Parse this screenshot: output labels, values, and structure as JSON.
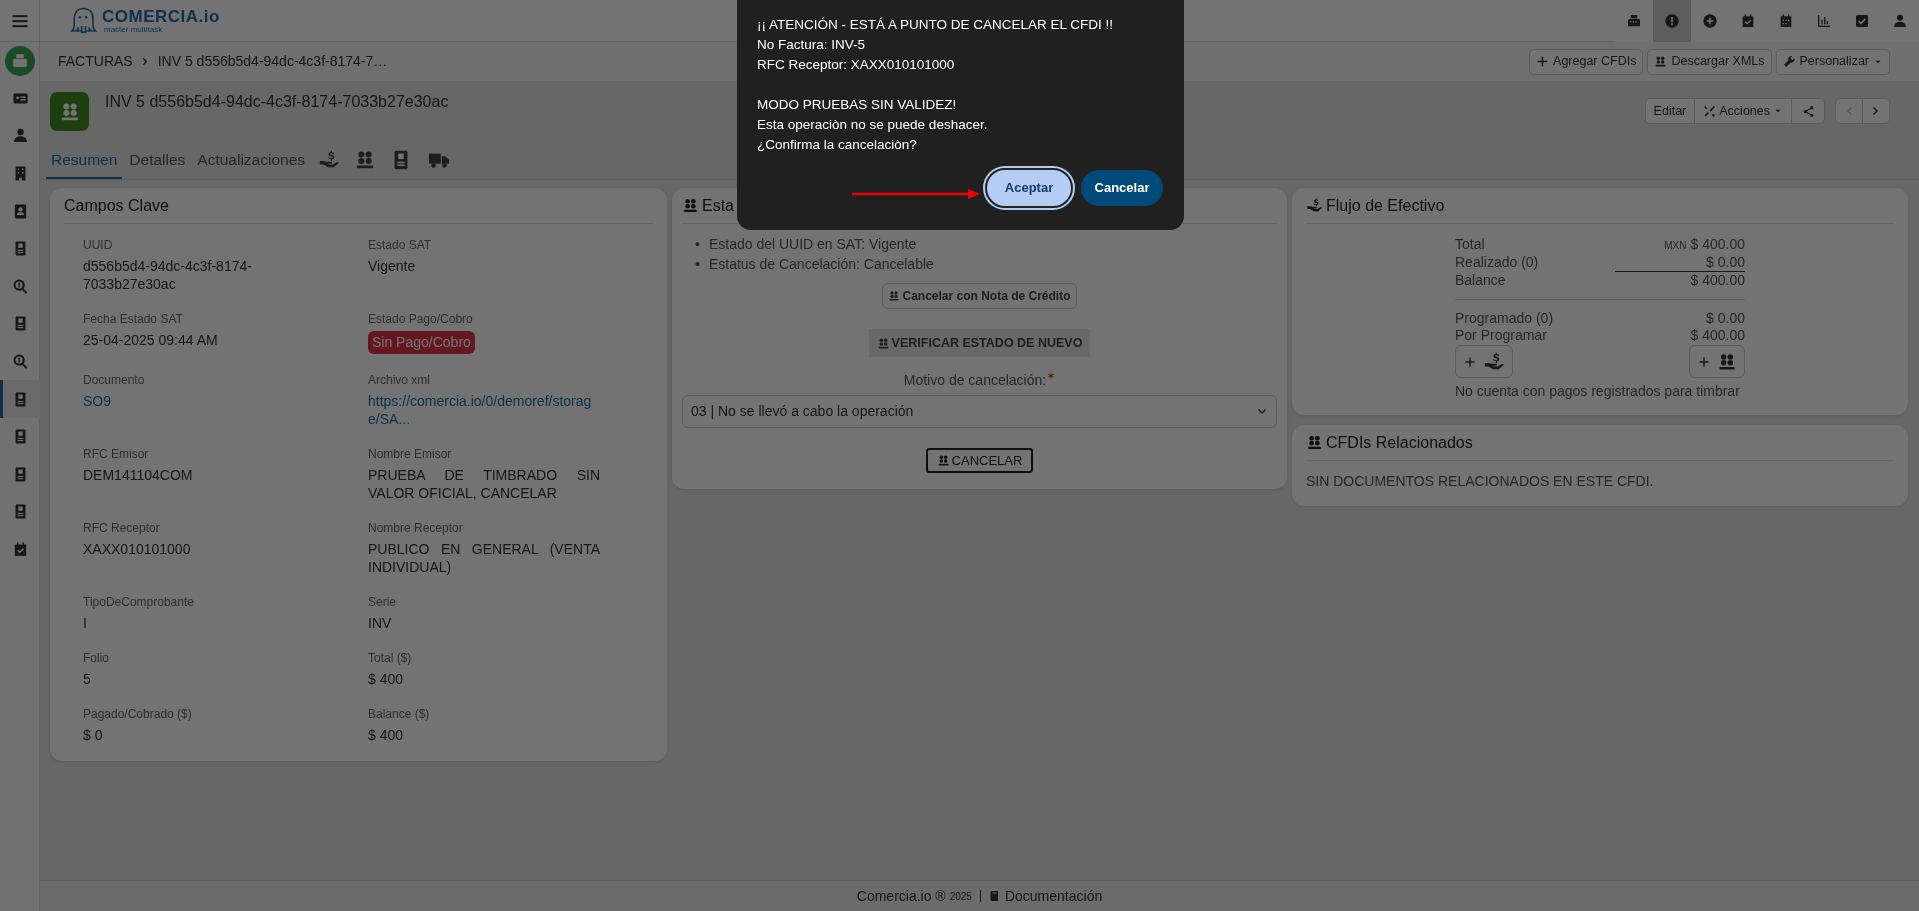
{
  "sidebar": {
    "items": [
      {
        "selected": false
      },
      {
        "selected": false
      },
      {
        "selected": false
      },
      {
        "selected": false
      },
      {
        "selected": false
      },
      {
        "selected": false
      },
      {
        "selected": false
      },
      {
        "selected": false
      },
      {
        "selected": false
      },
      {
        "selected": true
      },
      {
        "selected": false
      },
      {
        "selected": false
      },
      {
        "selected": false
      },
      {
        "selected": false
      }
    ]
  },
  "topbar": {
    "logo": {
      "name": "COMERCIA.io",
      "tagline": "master multitask"
    },
    "icons": [
      {
        "selected": false
      },
      {
        "selected": true
      },
      {
        "selected": false
      },
      {
        "selected": false
      },
      {
        "selected": false
      },
      {
        "selected": false
      },
      {
        "selected": false
      },
      {
        "selected": false
      }
    ]
  },
  "breadcrumb": [
    "FACTURAS",
    "INV 5 d556b5d4-94dc-4c3f-8174-7…"
  ],
  "toolbar_buttons": [
    "Agregar CFDIs",
    "Descargar XMLs",
    "Personalizar"
  ],
  "header": {
    "title": "INV 5 d556b5d4-94dc-4c3f-8174-7033b27e30ac",
    "actions": [
      "Editar",
      "Acciones"
    ]
  },
  "tabs": [
    {
      "label": "Resumen",
      "selected": true
    },
    {
      "label": "Detalles",
      "selected": false
    },
    {
      "label": "Actualizaciones",
      "selected": false
    }
  ],
  "icon_tabs": [
    {
      "selected": false
    },
    {
      "selected": false
    },
    {
      "selected": false
    },
    {
      "selected": false
    }
  ],
  "campos_clave": {
    "title": "Campos Clave",
    "fields": [
      {
        "label": "UUID",
        "value": "d556b5d4-94dc-4c3f-8174-7033b27e30ac",
        "kind": "text"
      },
      {
        "label": "Estado SAT",
        "value": "Vigente",
        "kind": "text"
      },
      {
        "label": "Fecha Estado SAT",
        "value": "25-04-2025 09:44 AM",
        "kind": "text"
      },
      {
        "label": "Estado Pago/Cobro",
        "value": "Sin Pago/Cobro",
        "kind": "badge"
      },
      {
        "label": "Documento",
        "value": "SO9",
        "kind": "link"
      },
      {
        "label": "Archivo xml",
        "value": "https://comercia.io/0/demoref/storage/SA...",
        "kind": "link"
      },
      {
        "label": "RFC Emisor",
        "value": "DEM141104COM",
        "kind": "text"
      },
      {
        "label": "Nombre Emisor",
        "value": "PRUEBA DE TIMBRADO SIN VALOR OFICIAL, CANCELAR",
        "kind": "text"
      },
      {
        "label": "RFC Receptor",
        "value": "XAXX010101000",
        "kind": "text"
      },
      {
        "label": "Nombre Receptor",
        "value": "PUBLICO EN GENERAL (VENTA INDIVIDUAL)",
        "kind": "text"
      },
      {
        "label": "TipoDeComprobante",
        "value": "I",
        "kind": "text"
      },
      {
        "label": "Serie",
        "value": "INV",
        "kind": "text"
      },
      {
        "label": "Folio",
        "value": "5",
        "kind": "text"
      },
      {
        "label": "Total ($)",
        "value": "$ 400",
        "kind": "text"
      },
      {
        "label": "Pagado/Cobrado ($)",
        "value": "$ 0",
        "kind": "text"
      },
      {
        "label": "Balance ($)",
        "value": "$ 400",
        "kind": "text"
      }
    ]
  },
  "estado_sat": {
    "title": "Esta",
    "items": [
      {
        "marker": "•",
        "text": "Estado del UUID en SAT: Vigente"
      },
      {
        "marker": "•",
        "text": "Estatus de Cancelación: Cancelable"
      }
    ],
    "credit_note_button": "Cancelar con Nota de Crédito",
    "verify_button": "VERIFICAR ESTADO DE NUEVO",
    "motivo": {
      "label": "Motivo de cancelación:",
      "required": true,
      "value": "03 | No se llevó a cabo la operación"
    },
    "cancel_button": "CANCELAR"
  },
  "flujo": {
    "title": "Flujo de Efectivo",
    "rows": [
      {
        "label": "Total",
        "currency": "MXN",
        "value": "$ 400.00"
      },
      {
        "label": "Realizado (0)",
        "value": "$ 0.00"
      },
      {
        "label": "Balance",
        "value": "$ 400.00"
      }
    ],
    "scheduled_rows": [
      {
        "label": "Programado (0)",
        "value": "$ 0.00"
      },
      {
        "label": "Por Programar",
        "value": "$ 400.00"
      }
    ],
    "note": "No cuenta con pagos registrados para timbrar"
  },
  "cfdis_relacionados": {
    "title": "CFDIs Relacionados",
    "message": "SIN DOCUMENTOS RELACIONADOS EN ESTE CFDI."
  },
  "footer": {
    "brand": "Comercia.io ®",
    "year": "2025",
    "link": "Documentación"
  },
  "dialog": {
    "paragraphs": [
      [
        "¡¡ ATENCIÓN - ESTÁ A PUNTO DE CANCELAR EL CFDI !!",
        "No Factura: INV-5",
        "RFC Receptor: XAXX010101000"
      ],
      [
        "MODO PRUEBAS SIN VALIDEZ!",
        "Esta operaciòn no se puede deshacer.",
        "¿Confirma la cancelaciòn?"
      ]
    ],
    "buttons": [
      {
        "label": "Aceptar",
        "kind": "primary"
      },
      {
        "label": "Cancelar",
        "kind": "secondary"
      }
    ]
  }
}
